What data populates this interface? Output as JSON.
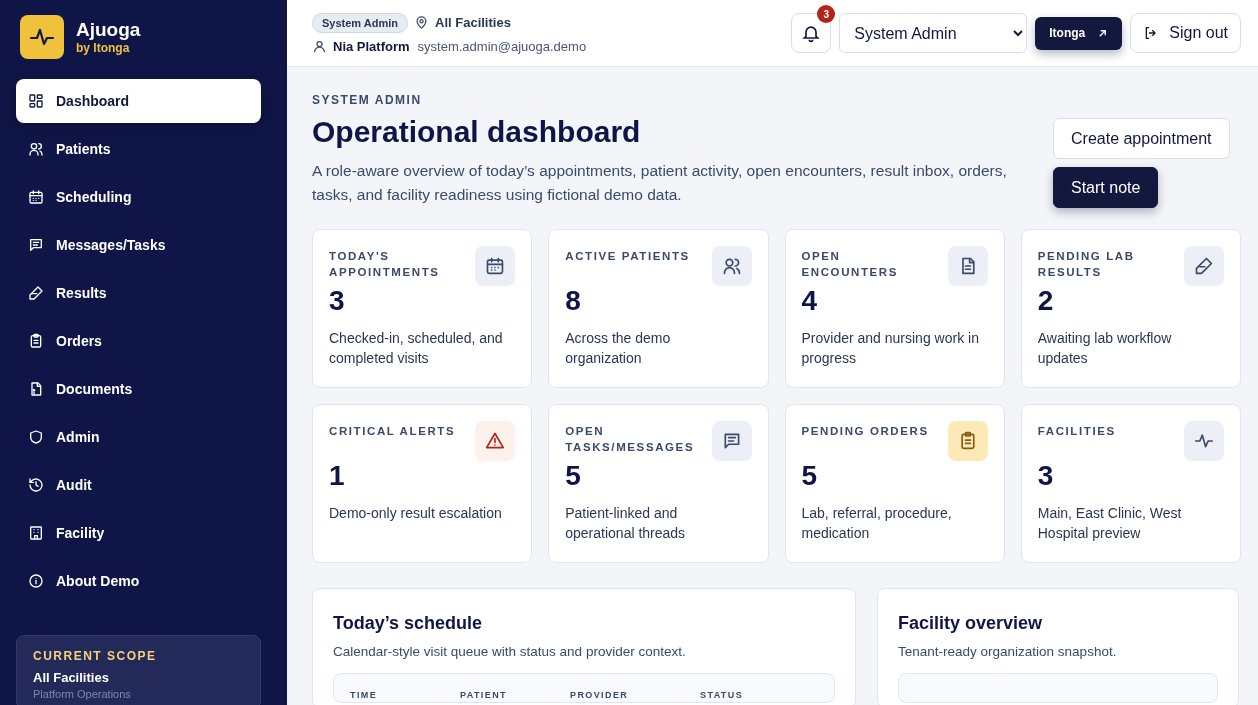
{
  "brand": {
    "name": "Ajuoga",
    "tagline": "by Itonga"
  },
  "nav": [
    {
      "label": "Dashboard",
      "selected": true
    },
    {
      "label": "Patients",
      "selected": false
    },
    {
      "label": "Scheduling",
      "selected": false
    },
    {
      "label": "Messages/Tasks",
      "selected": false
    },
    {
      "label": "Results",
      "selected": false
    },
    {
      "label": "Orders",
      "selected": false
    },
    {
      "label": "Documents",
      "selected": false
    },
    {
      "label": "Admin",
      "selected": false
    },
    {
      "label": "Audit",
      "selected": false
    },
    {
      "label": "Facility",
      "selected": false
    },
    {
      "label": "About Demo",
      "selected": false
    }
  ],
  "scope": {
    "heading": "CURRENT SCOPE",
    "value": "All Facilities",
    "detail": "Platform Operations"
  },
  "topbar": {
    "role_badge": "System Admin",
    "facility": "All Facilities",
    "user_name": "Nia Platform",
    "user_email": "system.admin@ajuoga.demo",
    "notifications": "3",
    "role_select": "System Admin",
    "brand_button": "Itonga",
    "sign_out": "Sign out"
  },
  "page": {
    "eyebrow": "SYSTEM ADMIN",
    "title": "Operational dashboard",
    "description": "A role-aware overview of today’s appointments, patient activity, open encounters, result inbox, orders, tasks, and facility readiness using fictional demo data.",
    "actions": [
      {
        "label": "Create appointment",
        "kind": "secondary"
      },
      {
        "label": "Start note",
        "kind": "primary"
      }
    ]
  },
  "stats": [
    {
      "label": "TODAY'S APPOINTMENTS",
      "value": "3",
      "note": "Checked-in, scheduled, and completed visits",
      "color": "#eceff5"
    },
    {
      "label": "ACTIVE PATIENTS",
      "value": "8",
      "note": "Across the demo organization",
      "color": "#eceff5"
    },
    {
      "label": "OPEN ENCOUNTERS",
      "value": "4",
      "note": "Provider and nursing work in progress",
      "color": "#eceff5"
    },
    {
      "label": "PENDING LAB RESULTS",
      "value": "2",
      "note": "Awaiting lab workflow updates",
      "color": "#eceff5"
    },
    {
      "label": "CRITICAL ALERTS",
      "value": "1",
      "note": "Demo-only result escalation",
      "color": "#fdf1ec"
    },
    {
      "label": "OPEN TASKS/MESSAGES",
      "value": "5",
      "note": "Patient-linked and operational threads",
      "color": "#eceff5"
    },
    {
      "label": "PENDING ORDERS",
      "value": "5",
      "note": "Lab, referral, procedure, medication",
      "color": "#fbeab8"
    },
    {
      "label": "FACILITIES",
      "value": "3",
      "note": "Main, East Clinic, West Hospital preview",
      "color": "#eceff5"
    }
  ],
  "schedule": {
    "title": "Today’s schedule",
    "subtitle": "Calendar-style visit queue with status and provider context.",
    "columns": [
      "TIME",
      "PATIENT",
      "PROVIDER",
      "STATUS"
    ]
  },
  "facility_overview": {
    "title": "Facility overview",
    "subtitle": "Tenant-ready organization snapshot."
  }
}
